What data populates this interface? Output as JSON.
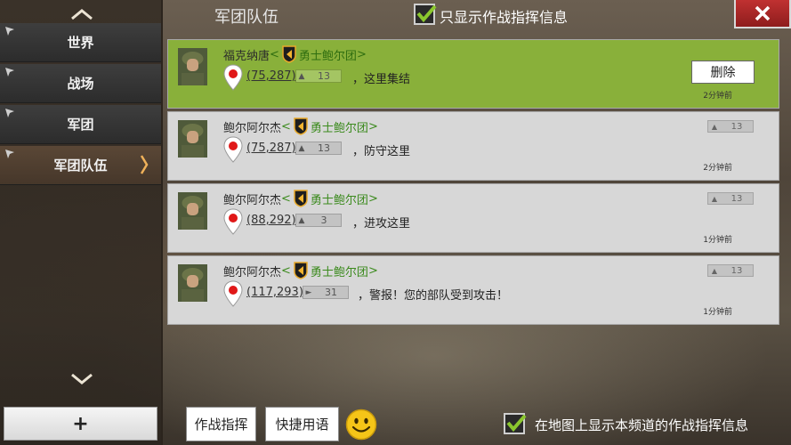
{
  "header": {
    "title": "军团队伍",
    "filter_label": "只显示作战指挥信息",
    "filter_checked": true
  },
  "sidebar": {
    "items": [
      {
        "label": "世界"
      },
      {
        "label": "战场"
      },
      {
        "label": "军团"
      },
      {
        "label": "军团队伍"
      }
    ],
    "add_label": "+"
  },
  "messages": [
    {
      "sender": "福克纳唐",
      "guild": "勇士鲍尔团",
      "coord": "(75,287)",
      "level_icon": "up-arrow",
      "level": "13",
      "text": "，这里集结",
      "time": "2分钟前",
      "action_label": "删除",
      "highlighted": true
    },
    {
      "sender": "鲍尔阿尔杰",
      "guild": "勇士鲍尔团",
      "coord": "(75,287)",
      "level_icon": "up-arrow",
      "level": "13",
      "text": "，防守这里",
      "time": "2分钟前",
      "right_level": "13"
    },
    {
      "sender": "鲍尔阿尔杰",
      "guild": "勇士鲍尔团",
      "coord": "(88,292)",
      "level_icon": "up-arrow",
      "level": "3",
      "text": "，进攻这里",
      "time": "1分钟前",
      "right_level": "13"
    },
    {
      "sender": "鲍尔阿尔杰",
      "guild": "勇士鲍尔团",
      "coord": "(117,293)",
      "level_icon": "right-arrow",
      "level": "31",
      "text": "，警报！您的部队受到攻击！",
      "time": "1分钟前",
      "right_level": "13"
    }
  ],
  "name_brackets": {
    "open": "<",
    "close": ">"
  },
  "footer": {
    "battle_command_label": "作战指挥",
    "quick_phrase_label": "快捷用语",
    "map_filter_label": "在地图上显示本频道的作战指挥信息",
    "map_filter_checked": true
  },
  "colors": {
    "highlight": "#89b03a",
    "guild_text": "#3b8a1d",
    "close_button": "#c03131"
  }
}
